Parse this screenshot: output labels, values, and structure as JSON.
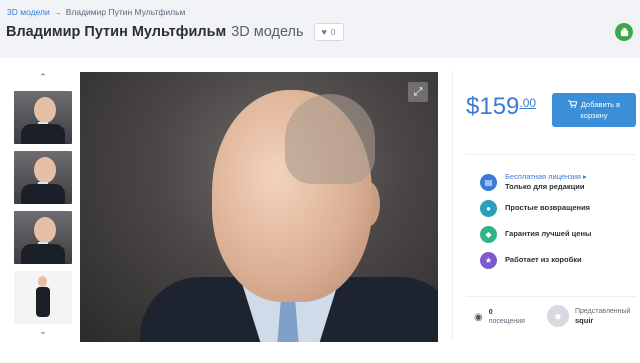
{
  "breadcrumb": {
    "link": "3D модели",
    "separator": "→",
    "current": "Владимир Путин Мультфильм"
  },
  "title": {
    "main": "Владимир Путин Мультфильм",
    "suffix": "3D модель"
  },
  "like": {
    "count": "0",
    "icon": "heart-icon"
  },
  "top_icon": {
    "icon": "android-icon",
    "color": "#3fa64a"
  },
  "thumbnails": {
    "up_arrow": "⌃",
    "down_arrow": "⌄"
  },
  "viewer": {
    "expand_icon": "expand-icon"
  },
  "price": {
    "dollars": "$159",
    "cents": ".00"
  },
  "cart": {
    "line1": "Добавить в",
    "line2": "корзину",
    "icon": "cart-icon"
  },
  "features": [
    {
      "icon": "document-icon",
      "color": "#3a7bd5",
      "link": "Бесплатная лицензия ▸",
      "text": "Только для редакции"
    },
    {
      "icon": "user-icon",
      "color": "#2aa1b8",
      "text": "Простые возвращения"
    },
    {
      "icon": "tag-icon",
      "color": "#2fb38a",
      "text": "Гарантия лучшей цены"
    },
    {
      "icon": "star-icon",
      "color": "#7a5ccf",
      "text": "Работает из коробки"
    }
  ],
  "views": {
    "count": "0",
    "label": "посещения"
  },
  "author": {
    "label": "Представленный",
    "name": "squir"
  }
}
